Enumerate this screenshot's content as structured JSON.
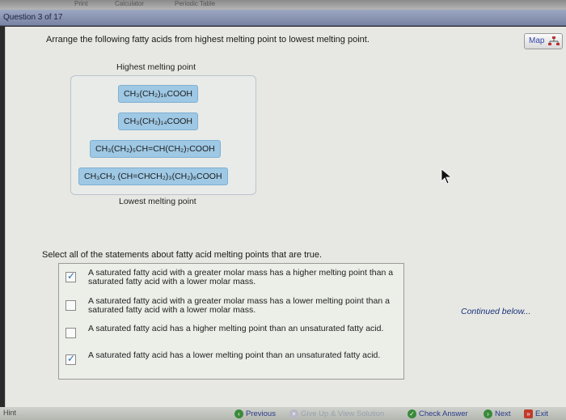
{
  "top_strip": {
    "items": [
      "Print",
      "Calculator",
      "Periodic Table"
    ]
  },
  "header": {
    "question_counter": "Question 3 of 17"
  },
  "map_button": {
    "label": "Map"
  },
  "ranking": {
    "prompt": "Arrange the following fatty acids from highest melting point to lowest melting point.",
    "highest_label": "Highest melting point",
    "lowest_label": "Lowest melting point",
    "items": [
      "CH₃(CH₂)₁₆COOH",
      "CH₃(CH₂)₁₄COOH",
      "CH₃(CH₂)₅CH=CH(CH₂)₇COOH",
      "CH₃CH₂ (CH=CHCH₂)₃(CH₂)₆COOH"
    ]
  },
  "statements": {
    "prompt": "Select all of the statements about fatty acid melting points that are true.",
    "options": [
      {
        "checked": true,
        "text": "A saturated fatty acid with a greater molar mass has a higher melting point than a saturated fatty acid with a lower molar mass."
      },
      {
        "checked": false,
        "text": "A saturated fatty acid with a greater molar mass has a lower melting point than a saturated fatty acid with a lower molar mass."
      },
      {
        "checked": false,
        "text": "A saturated fatty acid has a higher melting point than an unsaturated fatty acid."
      },
      {
        "checked": true,
        "text": "A saturated fatty acid has a lower melting point than an unsaturated fatty acid."
      }
    ],
    "continued": "Continued below..."
  },
  "bottom_nav": {
    "hint": "Hint",
    "previous": "Previous",
    "give_up": "Give Up & View Solution",
    "check_answer": "Check Answer",
    "next": "Next",
    "exit": "Exit"
  }
}
